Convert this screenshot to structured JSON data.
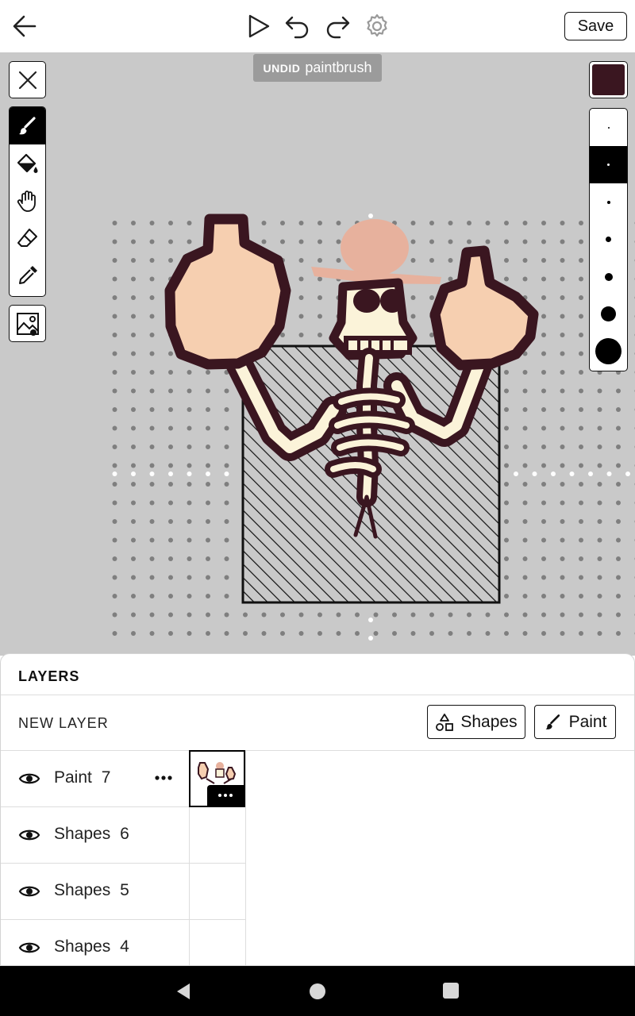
{
  "toolbar": {
    "save_label": "Save",
    "icons": [
      "back-arrow-icon",
      "play-icon",
      "undo-icon",
      "redo-icon",
      "gear-icon"
    ]
  },
  "toast": {
    "action": "UNDID",
    "tool": "paintbrush"
  },
  "canvas": {
    "background": "#c9c9c9",
    "tools": [
      "paintbrush",
      "paint-bucket",
      "hand",
      "eraser",
      "eyedropper"
    ],
    "active_tool": "paintbrush",
    "current_color": "#3a1620",
    "brush_sizes_count": 7,
    "active_brush_size_index": 1
  },
  "layers": {
    "title": "LAYERS",
    "new_layer_label": "NEW LAYER",
    "shapes_button": "Shapes",
    "paint_button": "Paint",
    "items": [
      {
        "name": "Paint",
        "number": "7"
      },
      {
        "name": "Shapes",
        "number": "6"
      },
      {
        "name": "Shapes",
        "number": "5"
      },
      {
        "name": "Shapes",
        "number": "4"
      }
    ]
  },
  "navbar": {
    "icons": [
      "nav-back-icon",
      "nav-home-icon",
      "nav-recents-icon"
    ]
  }
}
